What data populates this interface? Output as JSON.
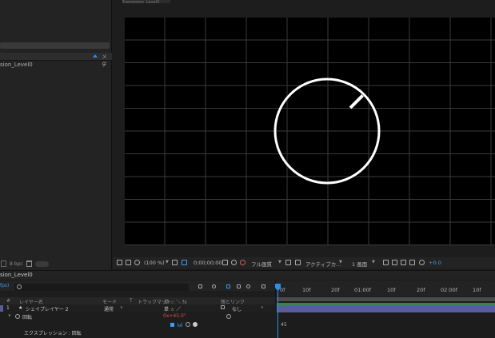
{
  "project_panel": {
    "column_label": "メデ",
    "item_name": "sion_Level0",
    "item_count": "0",
    "bpc_label": "8 bpc"
  },
  "comp_tab": {
    "label": "Expression_Level0"
  },
  "viewer_toolbar": {
    "zoom": "(100 %)",
    "timecode": "0;00;00;00",
    "resolution": "フル画質",
    "camera": "アクティブカ...",
    "views": "1 画面",
    "exposure": "+0.0"
  },
  "timeline": {
    "comp_name": "sion_Level0",
    "frame_rate": "fps)",
    "columns": {
      "num": "#",
      "layer_name": "レイヤー名",
      "mode": "モード",
      "t": "T",
      "track_matte": "トラックマット",
      "switches": "単 ☆ ＼ fx",
      "parent": "親とリンク"
    },
    "layers": [
      {
        "index": "1",
        "name": "シェイプレイヤー 2",
        "mode": "通常",
        "parent": "なし"
      }
    ],
    "property": {
      "name": "回転",
      "value": "0x+45.0°"
    },
    "expression": {
      "label": "エクスプレッション : 回転",
      "graph_value": "45"
    },
    "ruler_ticks": [
      "0f",
      "10f",
      "20f",
      "01:00f",
      "10f",
      "20f",
      "02:00f",
      "10f"
    ]
  },
  "colors": {
    "accent": "#2d8ceb",
    "layer_bar": "#5a5a9e",
    "layer_green": "#3d7f4d",
    "value_red": "#e04d4d"
  },
  "dial": {
    "angle_deg": 45
  }
}
